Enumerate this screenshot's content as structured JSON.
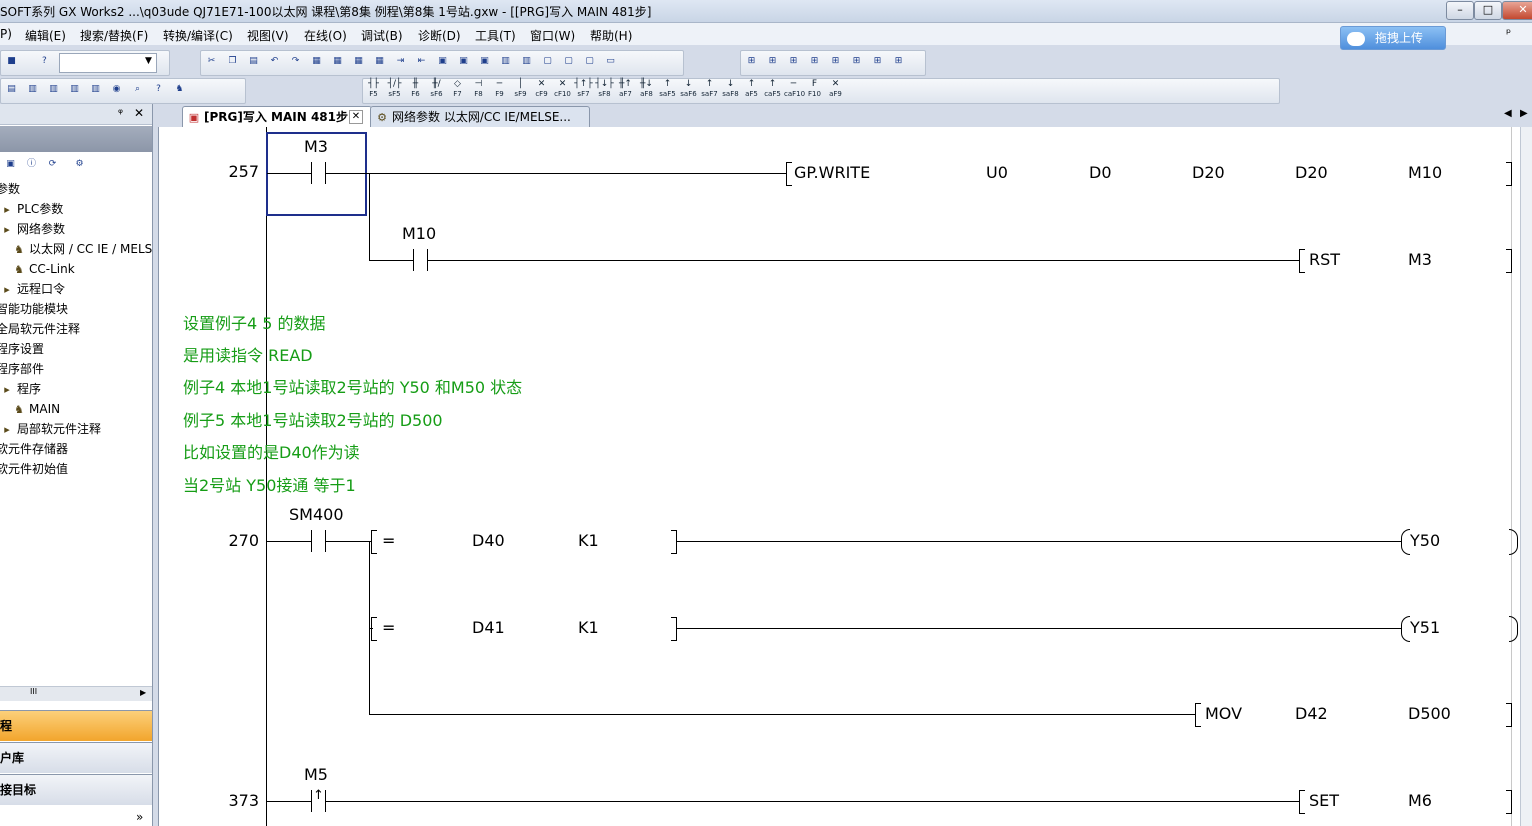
{
  "window": {
    "title": "SOFT系列 GX Works2 ...\\q03ude   QJ71E71-100以太网 课程\\第8集  例程\\第8集 1号站.gxw - [[PRG]写入 MAIN 481步]",
    "minimize": "–",
    "maximize": "□",
    "close": "✕"
  },
  "menu": {
    "items": [
      "P)",
      "编辑(E)",
      "搜索/替换(F)",
      "转换/编译(C)",
      "视图(V)",
      "在线(O)",
      "调试(B)",
      "诊断(D)",
      "工具(T)",
      "窗口(W)",
      "帮助(H)"
    ],
    "upload_button": "拖拽上传",
    "right_glyph": "ᵖ"
  },
  "function_keys": [
    "F5",
    "sF5",
    "F6",
    "sF6",
    "F7",
    "F8",
    "F9",
    "sF9",
    "cF9",
    "cF10",
    "sF7",
    "sF8",
    "aF7",
    "aF8",
    "saF5",
    "saF6",
    "saF7",
    "saF8",
    "aF5",
    "caF5",
    "caF10",
    "F10",
    "aF9"
  ],
  "left_panel": {
    "pin": "ᵠ",
    "close": "✕",
    "tree": [
      {
        "label": "参数",
        "indent": 0
      },
      {
        "label": "PLC参数",
        "indent": 1
      },
      {
        "label": "网络参数",
        "indent": 1
      },
      {
        "label": "以太网 / CC IE / MELS",
        "indent": 2
      },
      {
        "label": "CC-Link",
        "indent": 2
      },
      {
        "label": "远程口令",
        "indent": 1
      },
      {
        "label": "智能功能模块",
        "indent": 0
      },
      {
        "label": "全局软元件注释",
        "indent": 0
      },
      {
        "label": "程序设置",
        "indent": 0
      },
      {
        "label": "程序部件",
        "indent": 0
      },
      {
        "label": "程序",
        "indent": 1
      },
      {
        "label": "MAIN",
        "indent": 2
      },
      {
        "label": "局部软元件注释",
        "indent": 1
      },
      {
        "label": "软元件存储器",
        "indent": 0
      },
      {
        "label": "软元件初始值",
        "indent": 0
      }
    ],
    "scroll_thumb": "III",
    "nav_buttons": [
      "程",
      "户库",
      "接目标"
    ],
    "more": "»"
  },
  "tabs": [
    {
      "label": "[PRG]写入 MAIN 481步",
      "close": "✕",
      "active": true
    },
    {
      "label": "网络参数  以太网/CC IE/MELSE...",
      "active": false
    }
  ],
  "ladder": {
    "rungs": [
      {
        "step": "257",
        "contact": "M3",
        "instruction": [
          "GP.WRITE",
          "U0",
          "D0",
          "D20",
          "D20",
          "M10"
        ],
        "branch_contact": "M10",
        "branch_instruction": [
          "RST",
          "M3"
        ]
      },
      {
        "step": "270",
        "contact": "SM400",
        "compare1": [
          "=",
          "D40",
          "K1"
        ],
        "coil1": "Y50",
        "compare2": [
          "=",
          "D41",
          "K1"
        ],
        "coil2": "Y51",
        "mov": [
          "MOV",
          "D42",
          "D500"
        ]
      },
      {
        "step": "373",
        "contact": "M5",
        "instruction": [
          "SET",
          "M6"
        ]
      }
    ],
    "comments": [
      "设置例子4   5 的数据",
      "是用读指令  READ",
      "例子4 本地1号站读取2号站的 Y50 和M50 状态",
      "例子5 本地1号站读取2号站的 D500",
      "比如设置的是D40作为读",
      "当2号站 Y50接通 等于1"
    ]
  }
}
